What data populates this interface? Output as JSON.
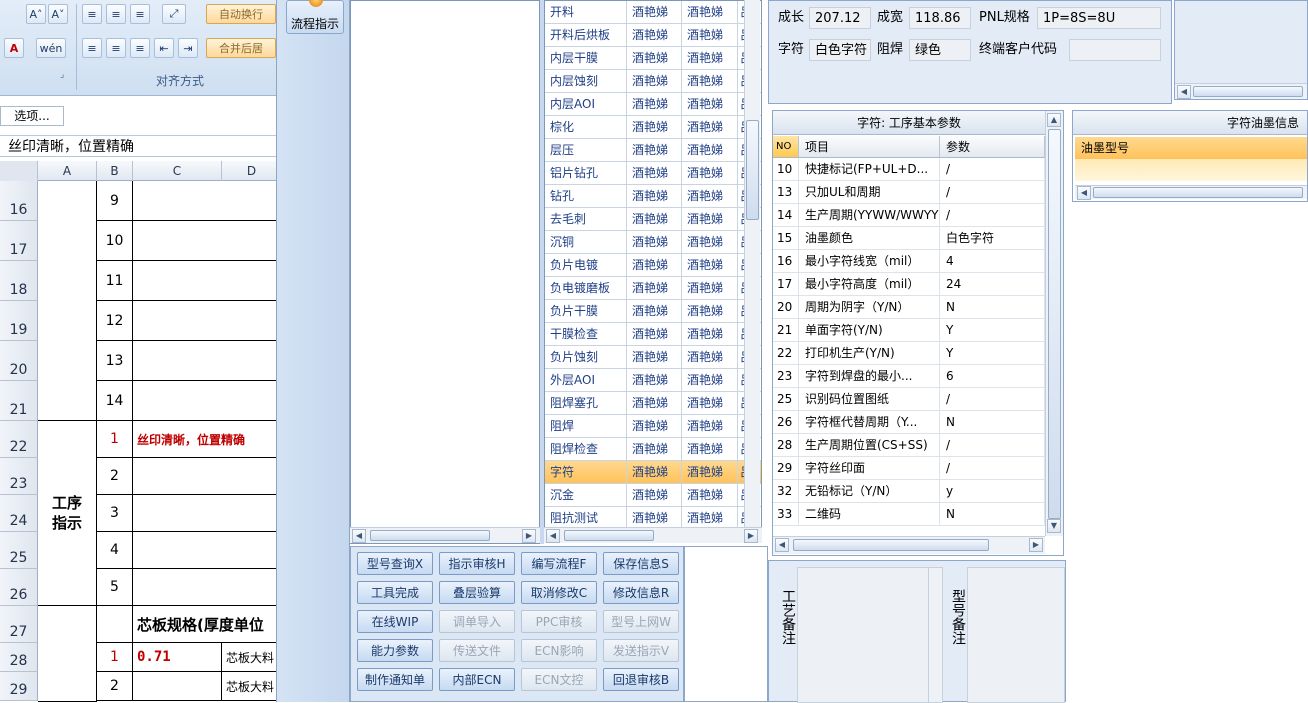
{
  "excel": {
    "ribbon_section_label": "对齐方式",
    "wrap_text_label": "自动换行",
    "merge_label": "合并后居",
    "phonetic_label": "wén",
    "options_button": "选项...",
    "formula_bar_text": "丝印清晰，位置精确",
    "columns": [
      "A",
      "B",
      "C",
      "D"
    ],
    "rows": [
      {
        "num": "16",
        "b": "9",
        "c": ""
      },
      {
        "num": "17",
        "b": "10",
        "c": ""
      },
      {
        "num": "18",
        "b": "11",
        "c": ""
      },
      {
        "num": "19",
        "b": "12",
        "c": ""
      },
      {
        "num": "20",
        "b": "13",
        "c": ""
      },
      {
        "num": "21",
        "b": "14",
        "c": ""
      },
      {
        "num": "22",
        "b": "1",
        "c": "丝印清晰，位置精确"
      },
      {
        "num": "23",
        "b": "2",
        "c": ""
      },
      {
        "num": "24",
        "b": "3",
        "c": ""
      },
      {
        "num": "25",
        "b": "4",
        "c": ""
      },
      {
        "num": "26",
        "b": "5",
        "c": ""
      },
      {
        "num": "27",
        "b": "",
        "c": "芯板规格(厚度单位"
      },
      {
        "num": "28",
        "b": "1",
        "c": "0.71",
        "d": "芯板大料"
      },
      {
        "num": "29",
        "b": "2",
        "c": "",
        "d": "芯板大料"
      }
    ],
    "merged_label": "工序\n指示"
  },
  "app": {
    "nav_button_label": "流程指示",
    "process_rows": [
      {
        "name": "开料",
        "c2": "酒艳娣",
        "c3": "酒艳娣",
        "c4": "吕"
      },
      {
        "name": "开料后烘板",
        "c2": "酒艳娣",
        "c3": "酒艳娣",
        "c4": "吕"
      },
      {
        "name": "内层干膜",
        "c2": "酒艳娣",
        "c3": "酒艳娣",
        "c4": "吕"
      },
      {
        "name": "内层蚀刻",
        "c2": "酒艳娣",
        "c3": "酒艳娣",
        "c4": "吕"
      },
      {
        "name": "内层AOI",
        "c2": "酒艳娣",
        "c3": "酒艳娣",
        "c4": "吕"
      },
      {
        "name": "棕化",
        "c2": "酒艳娣",
        "c3": "酒艳娣",
        "c4": "吕"
      },
      {
        "name": "层压",
        "c2": "酒艳娣",
        "c3": "酒艳娣",
        "c4": "吕"
      },
      {
        "name": "铝片钻孔",
        "c2": "酒艳娣",
        "c3": "酒艳娣",
        "c4": "吕"
      },
      {
        "name": "钻孔",
        "c2": "酒艳娣",
        "c3": "酒艳娣",
        "c4": "吕"
      },
      {
        "name": "去毛刺",
        "c2": "酒艳娣",
        "c3": "酒艳娣",
        "c4": "吕"
      },
      {
        "name": "沉铜",
        "c2": "酒艳娣",
        "c3": "酒艳娣",
        "c4": "吕"
      },
      {
        "name": "负片电镀",
        "c2": "酒艳娣",
        "c3": "酒艳娣",
        "c4": "吕"
      },
      {
        "name": "负电镀磨板",
        "c2": "酒艳娣",
        "c3": "酒艳娣",
        "c4": "吕"
      },
      {
        "name": "负片干膜",
        "c2": "酒艳娣",
        "c3": "酒艳娣",
        "c4": "吕"
      },
      {
        "name": "干膜检查",
        "c2": "酒艳娣",
        "c3": "酒艳娣",
        "c4": "吕"
      },
      {
        "name": "负片蚀刻",
        "c2": "酒艳娣",
        "c3": "酒艳娣",
        "c4": "吕"
      },
      {
        "name": "外层AOI",
        "c2": "酒艳娣",
        "c3": "酒艳娣",
        "c4": "吕"
      },
      {
        "name": "阻焊塞孔",
        "c2": "酒艳娣",
        "c3": "酒艳娣",
        "c4": "吕"
      },
      {
        "name": "阻焊",
        "c2": "酒艳娣",
        "c3": "酒艳娣",
        "c4": "吕"
      },
      {
        "name": "阻焊检查",
        "c2": "酒艳娣",
        "c3": "酒艳娣",
        "c4": "吕"
      },
      {
        "name": "字符",
        "c2": "酒艳娣",
        "c3": "酒艳娣",
        "c4": "吕",
        "selected": true
      },
      {
        "name": "沉金",
        "c2": "酒艳娣",
        "c3": "酒艳娣",
        "c4": "吕"
      },
      {
        "name": "阻抗测试",
        "c2": "酒艳娣",
        "c3": "酒艳娣",
        "c4": "吕"
      }
    ],
    "buttons": [
      [
        {
          "label": "型号查询X",
          "enabled": true
        },
        {
          "label": "指示审核H",
          "enabled": true
        },
        {
          "label": "编写流程F",
          "enabled": true
        },
        {
          "label": "保存信息S",
          "enabled": true
        }
      ],
      [
        {
          "label": "工具完成",
          "enabled": true
        },
        {
          "label": "叠层验算",
          "enabled": true
        },
        {
          "label": "取消修改C",
          "enabled": true
        },
        {
          "label": "修改信息R",
          "enabled": true
        }
      ],
      [
        {
          "label": "在线WIP",
          "enabled": true
        },
        {
          "label": "调单导入",
          "enabled": false
        },
        {
          "label": "PPC审核",
          "enabled": false
        },
        {
          "label": "型号上网W",
          "enabled": false
        }
      ],
      [
        {
          "label": "能力参数",
          "enabled": true
        },
        {
          "label": "传送文件",
          "enabled": false
        },
        {
          "label": "ECN影响",
          "enabled": false
        },
        {
          "label": "发送指示V",
          "enabled": false
        }
      ],
      [
        {
          "label": "制作通知单",
          "enabled": true
        },
        {
          "label": "内部ECN",
          "enabled": true
        },
        {
          "label": "ECN文控",
          "enabled": false
        },
        {
          "label": "回退审核B",
          "enabled": true
        }
      ]
    ],
    "info": {
      "row1": [
        {
          "label": "成长",
          "value": "207.12"
        },
        {
          "label": "成宽",
          "value": "118.86"
        },
        {
          "label": "PNL规格",
          "value": "1P=8S=8U"
        }
      ],
      "row2": [
        {
          "label": "字符",
          "value": "白色字符"
        },
        {
          "label": "阻焊",
          "value": "绿色"
        },
        {
          "label": "终端客户代码",
          "value": ""
        }
      ]
    },
    "param_table": {
      "title": "字符: 工序基本参数",
      "headers": [
        "NO",
        "项目",
        "参数"
      ],
      "rows": [
        [
          "10",
          "快捷标记(FP+UL+D...",
          "/"
        ],
        [
          "13",
          "只加UL和周期",
          "/"
        ],
        [
          "14",
          "生产周期(YYWW/WWYY)",
          "/"
        ],
        [
          "15",
          "油墨颜色",
          "白色字符"
        ],
        [
          "16",
          "最小字符线宽（mil）",
          "4"
        ],
        [
          "17",
          "最小字符高度（mil）",
          "24"
        ],
        [
          "20",
          "周期为阴字（Y/N）",
          "N"
        ],
        [
          "21",
          "单面字符(Y/N)",
          "Y"
        ],
        [
          "22",
          "打印机生产(Y/N)",
          "Y"
        ],
        [
          "23",
          "字符到焊盘的最小...",
          "6"
        ],
        [
          "25",
          "识别码位置图纸",
          "/"
        ],
        [
          "26",
          "字符框代替周期（Y...",
          "N"
        ],
        [
          "28",
          "生产周期位置(CS+SS)",
          "/"
        ],
        [
          "29",
          "字符丝印面",
          "/"
        ],
        [
          "32",
          "无铅标记（Y/N）",
          "y"
        ],
        [
          "33",
          "二维码",
          "N"
        ]
      ]
    },
    "ink_panel": {
      "title": "字符油墨信息",
      "header": "油墨型号"
    },
    "remarks": {
      "label1": "工艺备注",
      "label2": "型号备注"
    }
  },
  "colors": {
    "selected_row": "#ffc25a",
    "accent_arrow": "#e8617a",
    "link_text": "#1f3f86",
    "excel_red": "#c00000"
  }
}
